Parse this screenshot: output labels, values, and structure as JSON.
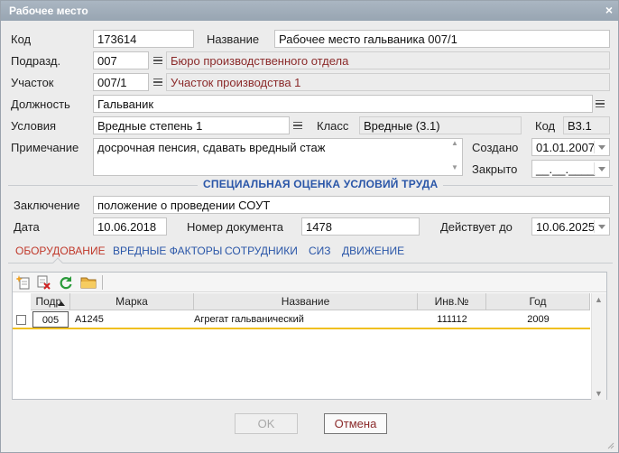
{
  "window": {
    "title": "Рабочее место",
    "close_glyph": "×"
  },
  "form": {
    "kod": {
      "label": "Код",
      "value": "173614"
    },
    "nazvanie": {
      "label": "Название",
      "value": "Рабочее место гальваника 007/1"
    },
    "podrazd": {
      "label": "Подразд.",
      "code": "007",
      "name": "Бюро производственного отдела"
    },
    "uchastok": {
      "label": "Участок",
      "code": "007/1",
      "name": "Участок производства 1"
    },
    "dolzhnost": {
      "label": "Должность",
      "value": "Гальваник"
    },
    "usloviya": {
      "label": "Условия",
      "value": "Вредные степень 1"
    },
    "klass": {
      "label": "Класс",
      "value": "Вредные (3.1)"
    },
    "kod2": {
      "label": "Код",
      "value": "В3.1"
    },
    "primechanie": {
      "label": "Примечание",
      "value": "досрочная пенсия, сдавать вредный стаж"
    },
    "sozdano": {
      "label": "Создано",
      "value": "01.01.2007"
    },
    "zakryto": {
      "label": "Закрыто",
      "value": "__.__.____"
    }
  },
  "sout": {
    "title": "СПЕЦИАЛЬНАЯ ОЦЕНКА УСЛОВИЙ ТРУДА",
    "zaklyuchenie": {
      "label": "Заключение",
      "value": "положение о проведении СОУТ"
    },
    "data": {
      "label": "Дата",
      "value": "10.06.2018"
    },
    "nomer": {
      "label": "Номер документа",
      "value": "1478"
    },
    "deystvuet": {
      "label": "Действует до",
      "value": "10.06.2025"
    }
  },
  "tabs": [
    "ОБОРУДОВАНИЕ",
    "ВРЕДНЫЕ ФАКТОРЫ",
    "СОТРУДНИКИ",
    "СИЗ",
    "ДВИЖЕНИЕ"
  ],
  "grid": {
    "columns": [
      "Подр.",
      "Марка",
      "Название",
      "Инв.№",
      "Год"
    ],
    "rows": [
      {
        "podr": "005",
        "marka": "A1245",
        "nazvanie": "Агрегат гальванический",
        "inv": "111112",
        "god": "2009"
      }
    ]
  },
  "buttons": {
    "ok": "OK",
    "cancel": "Отмена"
  },
  "colors": {
    "accent": "#2a56a8",
    "active_tab": "#c0392b",
    "ref_text": "#8b2a2a",
    "selection": "#f0c020"
  },
  "icons": [
    "close-icon",
    "list-icon",
    "chevron-down-icon",
    "add-row-icon",
    "delete-row-icon",
    "refresh-icon",
    "folder-icon",
    "sort-up-icon"
  ]
}
